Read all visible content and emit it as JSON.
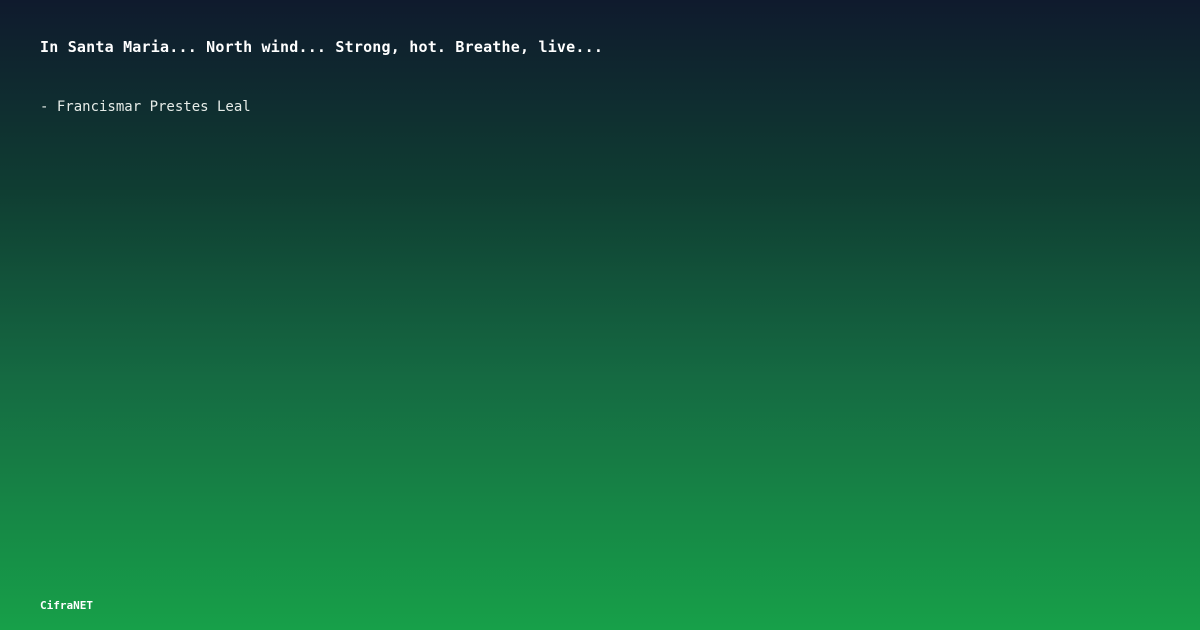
{
  "quote": {
    "text": "In Santa Maria... North wind... Strong, hot. Breathe, live...",
    "author": "- Francismar Prestes Leal"
  },
  "brand": {
    "name": "CifraNET"
  },
  "colors": {
    "gradient_top": "#0f1a2d",
    "gradient_bottom": "#17a049",
    "text": "#ffffff"
  }
}
